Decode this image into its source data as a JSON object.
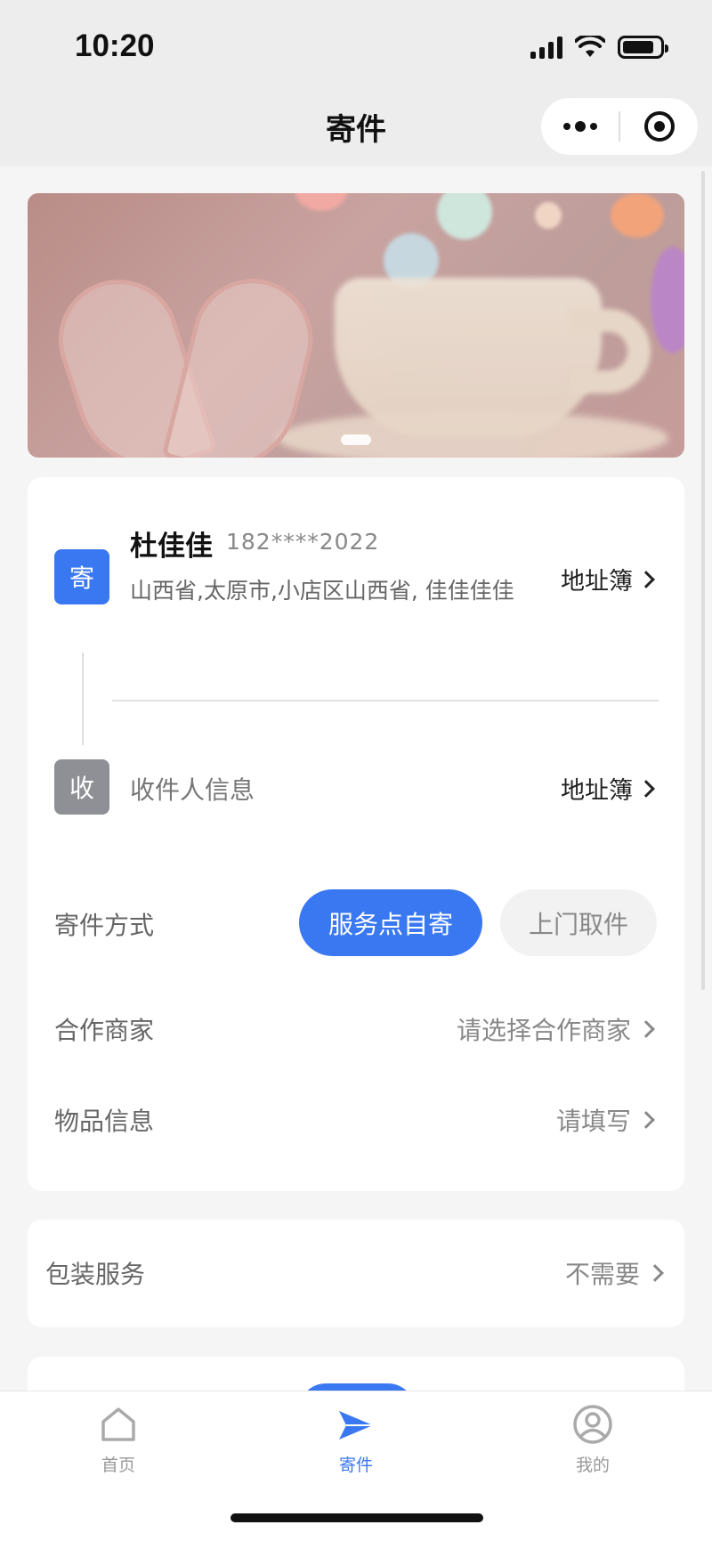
{
  "status_bar": {
    "time": "10:20"
  },
  "nav": {
    "title": "寄件"
  },
  "sender": {
    "tag": "寄",
    "name": "杜佳佳",
    "phone": "182****2022",
    "address": "山西省,太原市,小店区山西省, 佳佳佳佳",
    "address_book_label": "地址簿"
  },
  "recipient": {
    "tag": "收",
    "placeholder": "收件人信息",
    "address_book_label": "地址簿"
  },
  "send_method": {
    "label": "寄件方式",
    "options": [
      "服务点自寄",
      "上门取件"
    ],
    "selected": "服务点自寄"
  },
  "merchant": {
    "label": "合作商家",
    "value": "请选择合作商家"
  },
  "item_info": {
    "label": "物品信息",
    "value": "请填写"
  },
  "packaging": {
    "label": "包装服务",
    "value": "不需要"
  },
  "tabbar": {
    "items": [
      {
        "label": "首页",
        "icon": "home-icon"
      },
      {
        "label": "寄件",
        "icon": "paper-plane-icon",
        "active": true
      },
      {
        "label": "我的",
        "icon": "profile-icon"
      }
    ]
  },
  "colors": {
    "accent": "#3a78f2",
    "recv_tag": "#8e9095"
  }
}
